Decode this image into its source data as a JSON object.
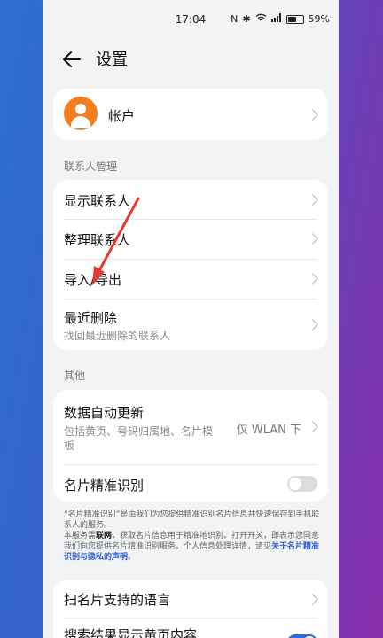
{
  "status": {
    "time": "17:04",
    "battery": "59%",
    "icons": [
      "nfc-icon",
      "bluetooth-icon",
      "wifi-icon",
      "signal-icon"
    ]
  },
  "header": {
    "title": "设置"
  },
  "account": {
    "label": "帐户"
  },
  "contacts_section": {
    "title": "联系人管理",
    "items": [
      {
        "label": "显示联系人"
      },
      {
        "label": "整理联系人"
      },
      {
        "label": "导入/导出"
      },
      {
        "label": "最近删除",
        "sub": "找回最近删除的联系人"
      }
    ]
  },
  "other_section": {
    "title": "其他",
    "auto_update": {
      "label": "数据自动更新",
      "sub_line1": "包括黄页、号码归属地、名片模",
      "sub_line2": "板",
      "value": "仅 WLAN 下"
    },
    "card_recognition": {
      "label": "名片精准识别",
      "enabled": false
    }
  },
  "note": {
    "line1": "“名片精准识别”是由我们为您提供精准识别名片信息并快速保存到手机联系人的服务。",
    "line2a": "本服务需",
    "line2b": "联网",
    "line2c": "，获取名片信息用于精准地识别。打开开关，即表示您同意我们向您提供名片精准识别服务。个人信息处理详情，请见",
    "link": "关于名片精准识别与隐私的声明",
    "end": "。"
  },
  "lang_section": {
    "scan_lang": {
      "label": "扫名片支持的语言"
    },
    "yellow_pages": {
      "label": "搜索结果显示黄页内容",
      "enabled": true
    }
  },
  "colors": {
    "accent": "#2f6bd6",
    "avatar": "#f57c1f",
    "annotation": "#e53935"
  }
}
